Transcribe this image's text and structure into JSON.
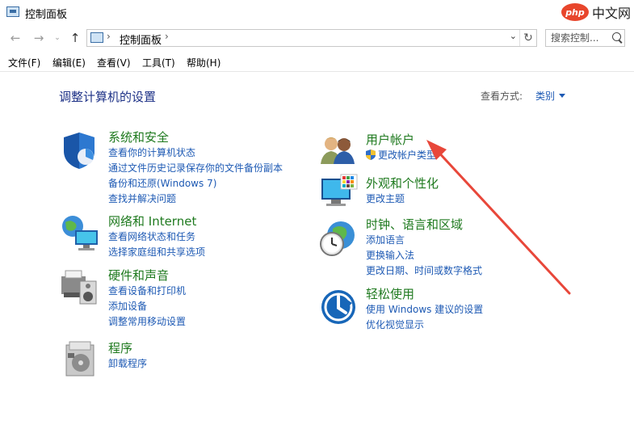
{
  "window": {
    "title": "控制面板",
    "watermark_logo": "php",
    "watermark_text": "中文网"
  },
  "nav": {
    "back_icon": "arrow-left-icon",
    "forward_icon": "arrow-right-icon",
    "up_icon": "arrow-up-icon",
    "address_separator": "›",
    "address_text": "控制面板",
    "address_trailing_separator": "›",
    "dropdown_glyph": "⌄",
    "refresh_glyph": "↻",
    "search_placeholder": "搜索控制..."
  },
  "menu": [
    {
      "label": "文件(F)"
    },
    {
      "label": "编辑(E)"
    },
    {
      "label": "查看(V)"
    },
    {
      "label": "工具(T)"
    },
    {
      "label": "帮助(H)"
    }
  ],
  "main": {
    "heading": "调整计算机的设置",
    "view_by_label": "查看方式:",
    "view_by_value": "类别"
  },
  "categories": {
    "security": {
      "title": "系统和安全",
      "links": [
        "查看你的计算机状态",
        "通过文件历史记录保存你的文件备份副本",
        "备份和还原(Windows 7)",
        "查找并解决问题"
      ]
    },
    "network": {
      "title": "网络和 Internet",
      "links": [
        "查看网络状态和任务",
        "选择家庭组和共享选项"
      ]
    },
    "hardware": {
      "title": "硬件和声音",
      "links": [
        "查看设备和打印机",
        "添加设备",
        "调整常用移动设置"
      ]
    },
    "programs": {
      "title": "程序",
      "links": [
        "卸载程序"
      ]
    },
    "users": {
      "title": "用户帐户",
      "links": [
        "更改帐户类型"
      ]
    },
    "appearance": {
      "title": "外观和个性化",
      "links": [
        "更改主题"
      ]
    },
    "clock": {
      "title": "时钟、语言和区域",
      "links": [
        "添加语言",
        "更换输入法",
        "更改日期、时间或数字格式"
      ]
    },
    "ease": {
      "title": "轻松使用",
      "links": [
        "使用 Windows 建议的设置",
        "优化视觉显示"
      ]
    }
  },
  "colors": {
    "category_title": "#1f7a1f",
    "link": "#1e5ab4",
    "heading": "#1e3287",
    "annotation_arrow": "#e8473a"
  }
}
